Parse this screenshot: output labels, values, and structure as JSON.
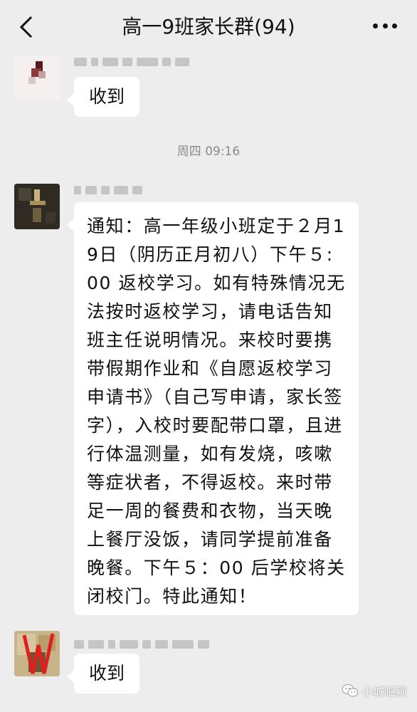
{
  "header": {
    "title": "高一9班家长群(94)"
  },
  "messages": [
    {
      "text": "收到"
    },
    {
      "text": "通知：高一年级小班定于２月19日（阴历正月初八）下午５:00 返校学习。如有特殊情况无法按时返校学习，请电话告知班主任说明情况。来校时要携带假期作业和《自愿返校学习申请书》（自己写申请，家长签字），入校时要配带口罩，且进行体温测量，如有发烧，咳嗽等症状者，不得返校。来时带足一周的餐费和衣物，当天晚上餐厅没饭，请同学提前准备晚餐。下午５：00 后学校将关闭校门。特此通知！"
    },
    {
      "text": "收到"
    }
  ],
  "timestamp": "周四 09:16",
  "watermark": "小城临颍",
  "icons": {
    "back": "back-arrow-icon",
    "more": "more-dots-icon",
    "watermark": "wechat-logo-icon"
  },
  "colors": {
    "background": "#ededed",
    "bubble": "#ffffff",
    "timestamp": "#8a8a8a"
  }
}
